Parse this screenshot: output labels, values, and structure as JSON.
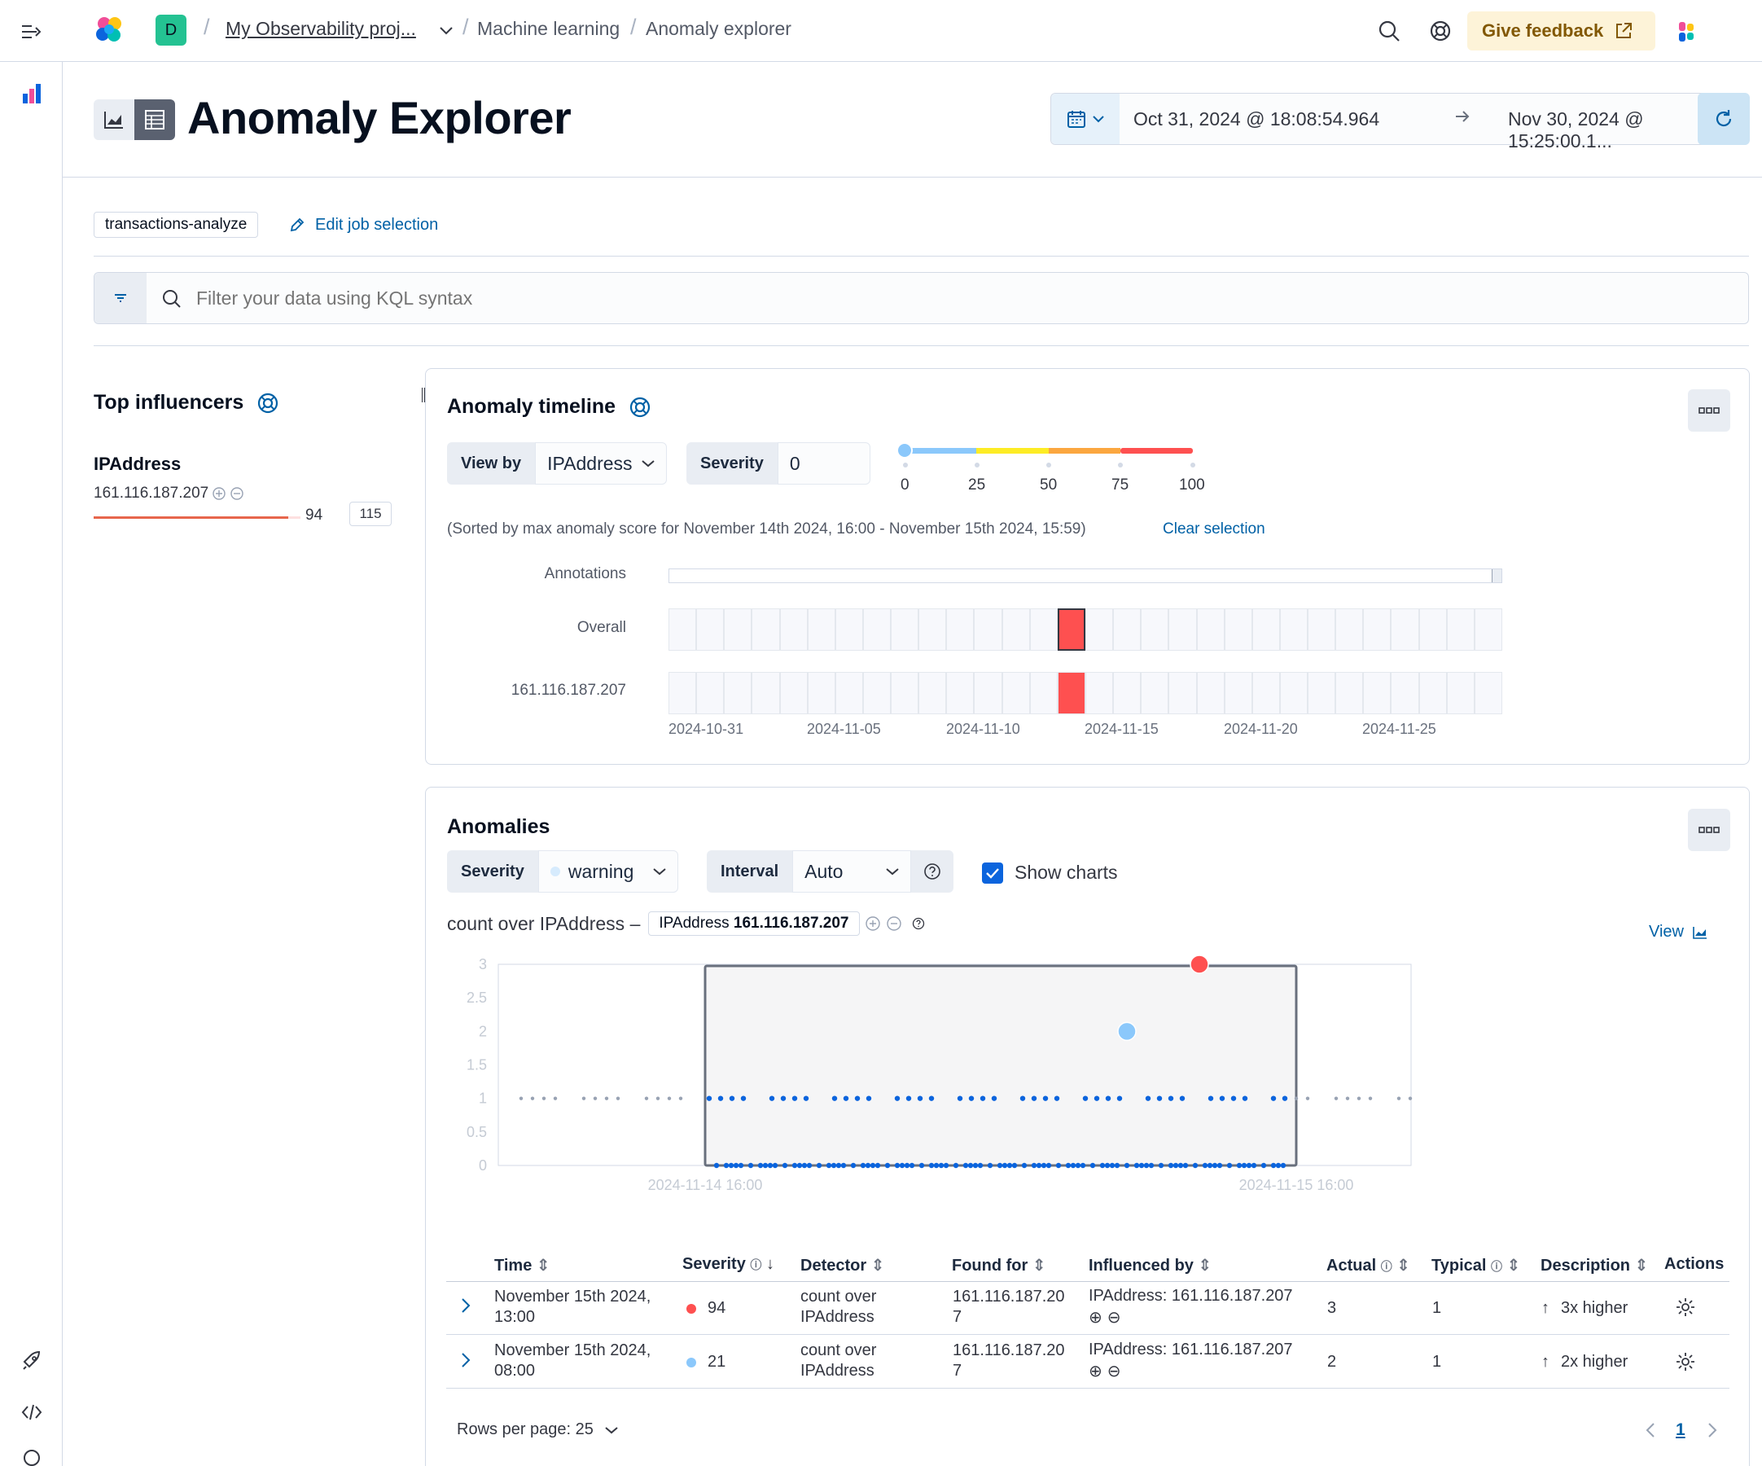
{
  "header": {
    "project_avatar": "D",
    "breadcrumbs": [
      "My Observability proj...",
      "Machine learning",
      "Anomaly explorer"
    ],
    "feedback_label": "Give feedback",
    "icons": [
      "menu-toggle-icon",
      "elastic-logo-icon",
      "search-icon",
      "help-icon",
      "external-link-icon",
      "apps-icon"
    ]
  },
  "page": {
    "title": "Anomaly Explorer",
    "date_start": "Oct 31, 2024 @ 18:08:54.964",
    "date_end": "Nov 30, 2024 @ 15:25:00.1...",
    "job_badge": "transactions-analyze",
    "edit_job_label": "Edit job selection",
    "query_placeholder": "Filter your data using KQL syntax"
  },
  "influencers": {
    "title": "Top influencers",
    "field": "IPAddress",
    "items": [
      {
        "value": "161.116.187.207",
        "score": "94",
        "total": "115",
        "fill": 0.94
      }
    ]
  },
  "timeline": {
    "title": "Anomaly timeline",
    "view_by_label": "View by",
    "view_by_value": "IPAddress",
    "severity_label": "Severity",
    "severity_value": "0",
    "severity_ticks": [
      "0",
      "25",
      "50",
      "75",
      "100"
    ],
    "sorted_note": "(Sorted by max anomaly score for November 14th 2024, 16:00 - November 15th 2024, 15:59)",
    "clear_selection": "Clear selection",
    "rows": [
      "Annotations",
      "Overall",
      "161.116.187.207"
    ],
    "x_ticks": [
      "2024-10-31",
      "2024-11-05",
      "2024-11-10",
      "2024-11-15",
      "2024-11-20",
      "2024-11-25"
    ],
    "colors": {
      "low": "#8bc8fb",
      "warning": "#fdec25",
      "minor": "#fba740",
      "major": "#fe5050"
    }
  },
  "anomalies": {
    "title": "Anomalies",
    "severity_label": "Severity",
    "severity_value": "warning",
    "interval_label": "Interval",
    "interval_value": "Auto",
    "show_charts_label": "Show charts",
    "chart_title_prefix": "count over IPAddress –",
    "chart_entity_field": "IPAddress",
    "chart_entity_value": "161.116.187.207",
    "view_label": "View",
    "columns": [
      "Time",
      "Severity",
      "Detector",
      "Found for",
      "Influenced by",
      "Actual",
      "Typical",
      "Description",
      "Actions"
    ],
    "rows": [
      {
        "time1": "November 15th 2024,",
        "time2": "13:00",
        "score": "94",
        "score_color": "#fe5050",
        "det1": "count over",
        "det2": "IPAddress",
        "found1": "161.116.187.20",
        "found2": "7",
        "influenced": "IPAddress: 161.116.187.207",
        "actual": "3",
        "typical": "1",
        "description": "3x higher"
      },
      {
        "time1": "November 15th 2024,",
        "time2": "08:00",
        "score": "21",
        "score_color": "#8bc8fb",
        "det1": "count over",
        "det2": "IPAddress",
        "found1": "161.116.187.20",
        "found2": "7",
        "influenced": "IPAddress: 161.116.187.207",
        "actual": "2",
        "typical": "1",
        "description": "2x higher"
      }
    ],
    "rows_per_page": "Rows per page: 25",
    "page": "1"
  },
  "chart_data": {
    "type": "scatter",
    "title": "count over IPAddress – IPAddress 161.116.187.207",
    "xlabel": "",
    "ylabel": "",
    "ylim": [
      0,
      3
    ],
    "y_ticks": [
      "0",
      "0.5",
      "1",
      "1.5",
      "2",
      "2.5",
      "3"
    ],
    "x_ticks": [
      "2024-11-14 16:00",
      "2024-11-15 16:00"
    ],
    "selection": [
      "2024-11-14 16:00",
      "2024-11-15 16:00"
    ],
    "series": [
      {
        "name": "anomalies",
        "points": [
          {
            "x": "2024-11-15 13:00",
            "y": 3,
            "score": 94,
            "color": "#fe5050"
          },
          {
            "x": "2024-11-15 08:00",
            "y": 2,
            "score": 21,
            "color": "#8bc8fb"
          }
        ]
      }
    ],
    "baseline_values": [
      0,
      1
    ],
    "grid": false,
    "legend": "none"
  }
}
